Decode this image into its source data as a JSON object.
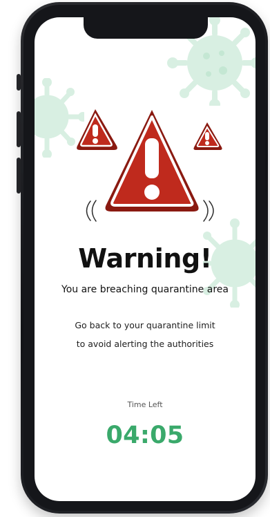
{
  "screen": {
    "title": "Warning!",
    "subtitle": "You are breaching quarantine area",
    "message_lines": [
      "Go back to your quarantine limit",
      "to avoid alerting the authorities"
    ],
    "time_left_label": "Time Left",
    "countdown": "04:05"
  },
  "theme": {
    "warning_red": "#bf2a1d",
    "warning_outline": "#8a1a11",
    "success_green": "#3aa96b",
    "virus_tint": "#d8efe2",
    "phone_frame": "#15161a"
  },
  "icons": {
    "main_alert": "warning-triangle-icon",
    "small_alerts": [
      "warning-triangle-icon",
      "warning-triangle-icon"
    ],
    "decor": [
      "virus-icon",
      "virus-icon",
      "virus-icon"
    ]
  }
}
